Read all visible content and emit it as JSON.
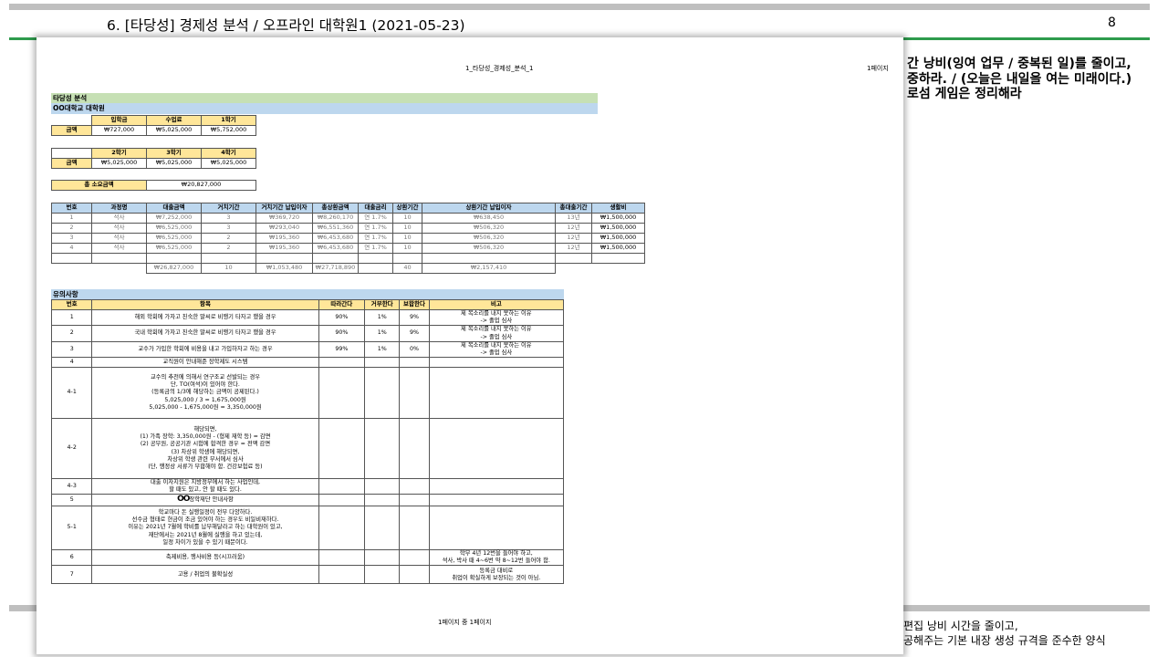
{
  "slide": {
    "title": "6. [타당성] 경제성 분석 / 오프라인 대학원1 (2021-05-23)",
    "page_number": "8",
    "right_lines": [
      "간 낭비(잉여 업무 / 중복된 일)를 줄이고,",
      "중하라. / (오늘은 내일을 여는 미래이다.)",
      "로섬 게임은 정리해라"
    ],
    "bottom_lines": [
      "편집 낭비 시간을 줄이고,",
      "공해주는 기본 내장 생성 규격을 준수한 양식"
    ]
  },
  "sheet": {
    "header_center": "1_타당성_경제성_분석_1",
    "header_right": "1페이지",
    "footer": "1페이지 중 1페이지",
    "band_title": "타당성 분석",
    "band_subtitle": "OO대학교 대학원",
    "fees1": {
      "headers": [
        "입학금",
        "수업료",
        "1학기"
      ],
      "row_label": "금액",
      "values": [
        "₩727,000",
        "₩5,025,000",
        "₩5,752,000"
      ]
    },
    "fees2": {
      "headers": [
        "2학기",
        "3학기",
        "4학기"
      ],
      "row_label": "금액",
      "values": [
        "₩5,025,000",
        "₩5,025,000",
        "₩5,025,000"
      ]
    },
    "total": {
      "label": "총 소요금액",
      "value": "₩20,827,000"
    },
    "loan": {
      "headers": [
        "번호",
        "과정명",
        "대출금액",
        "거치기간",
        "거치기간 납입이자",
        "총상환금액",
        "대출금리",
        "상환기간",
        "상환기간 납입이자",
        "총대출기간",
        "생활비"
      ],
      "rows": [
        [
          "1",
          "석사",
          "₩7,252,000",
          "3",
          "₩369,720",
          "₩8,260,170",
          "연 1.7%",
          "10",
          "₩638,450",
          "13년",
          "₩1,500,000"
        ],
        [
          "2",
          "석사",
          "₩6,525,000",
          "3",
          "₩293,040",
          "₩6,551,360",
          "연 1.7%",
          "10",
          "₩506,320",
          "12년",
          "₩1,500,000"
        ],
        [
          "3",
          "석사",
          "₩6,525,000",
          "2",
          "₩195,360",
          "₩6,453,680",
          "연 1.7%",
          "10",
          "₩506,320",
          "12년",
          "₩1,500,000"
        ],
        [
          "4",
          "석사",
          "₩6,525,000",
          "2",
          "₩195,360",
          "₩6,453,680",
          "연 1.7%",
          "10",
          "₩506,320",
          "12년",
          "₩1,500,000"
        ]
      ],
      "totals": [
        "₩26,827,000",
        "10",
        "₩1,053,480",
        "₩27,718,890",
        "40",
        "₩2,157,410"
      ]
    },
    "notes_title": "유의사항",
    "notes": {
      "headers": [
        "번호",
        "항목",
        "따라간다",
        "거부한다",
        "보합한다",
        "비고"
      ],
      "rows": [
        {
          "no": "1",
          "item": "해외 학회에 가자고 친숙한 말씨로 비행기 타자고 했을 경우",
          "a": "90%",
          "b": "1%",
          "c": "9%",
          "note": "제 목소리를 내지 못하는 이유\n-> 졸업 심사"
        },
        {
          "no": "2",
          "item": "국내 학회에 가자고 친숙한 말씨로 비행기 타자고 했을 경우",
          "a": "90%",
          "b": "1%",
          "c": "9%",
          "note": "제 목소리를 내지 못하는 이유\n-> 졸업 심사"
        },
        {
          "no": "3",
          "item": "교수가 가입한 학회에 비용을 내고 가입하자고 하는 경우",
          "a": "99%",
          "b": "1%",
          "c": "0%",
          "note": "제 목소리를 내지 못하는 이유\n-> 졸업 심사"
        },
        {
          "no": "4",
          "item": "교직원이 안내해준 장학제도 시스템",
          "a": "",
          "b": "",
          "c": "",
          "note": ""
        },
        {
          "no": "4-1",
          "item": "교수의 추천에 의해서 연구조교 선발되는 경우\n단, TO(여석)이 있어야 한다.\n(등록금의 1/3에 해당하는 금액이 공제된다.)\n5,025,000 / 3 = 1,675,000원\n5,025,000 - 1,675,000원 = 3,350,000원",
          "a": "",
          "b": "",
          "c": "",
          "note": ""
        },
        {
          "no": "4-2",
          "item": "해당되면,\n(1) 가족 장학: 3,350,000원 - (형제 재학 등) = 감면\n(2) 공무원, 공공기관 시험에 합격한 경우 = 전액 감면\n(3) 차상위 학생에 해당되면,\n차상위 학생 관련 부서에서 심사\n(단, 행정상 서류가 부합해야 함. 건강보험료 등)",
          "a": "",
          "b": "",
          "c": "",
          "note": ""
        },
        {
          "no": "4-3",
          "item": "대출 이자지원은 지방정부에서 하는 사업인데,\n할 때도 있고, 안 할 때도 있다.",
          "a": "",
          "b": "",
          "c": "",
          "note": ""
        },
        {
          "no": "5",
          "item": "장학재단 안내사항",
          "a": "",
          "b": "",
          "c": "",
          "note": ""
        },
        {
          "no": "5-1",
          "item": "학교마다 돈 실행일정이 전부 다양하다.\n선수금 형태로 현금이 조금 있어야 하는 경우도 비일비재하다.\n이유는 2021년 7월에 학비를 납부해달라고 하는 대학원이 있고,\n재단에서는 2021년 8월에 실행을 하고 있는데,\n일정 차이가 있을 수 있기 때문이다.",
          "a": "",
          "b": "",
          "c": "",
          "note": ""
        },
        {
          "no": "6",
          "item": "축제비용, 행사비용 등(시끄러움)",
          "a": "",
          "b": "",
          "c": "",
          "note": "학부 4년 12번을 들어야 하고,\n석사, 박사 때 4~6번 약 8~12번 들어야 함."
        },
        {
          "no": "7",
          "item": "고용 / 취업의 불확실성",
          "a": "",
          "b": "",
          "c": "",
          "note": "등록금 대비로\n취업이 확실하게 보장되는 것이 아님."
        }
      ]
    }
  }
}
